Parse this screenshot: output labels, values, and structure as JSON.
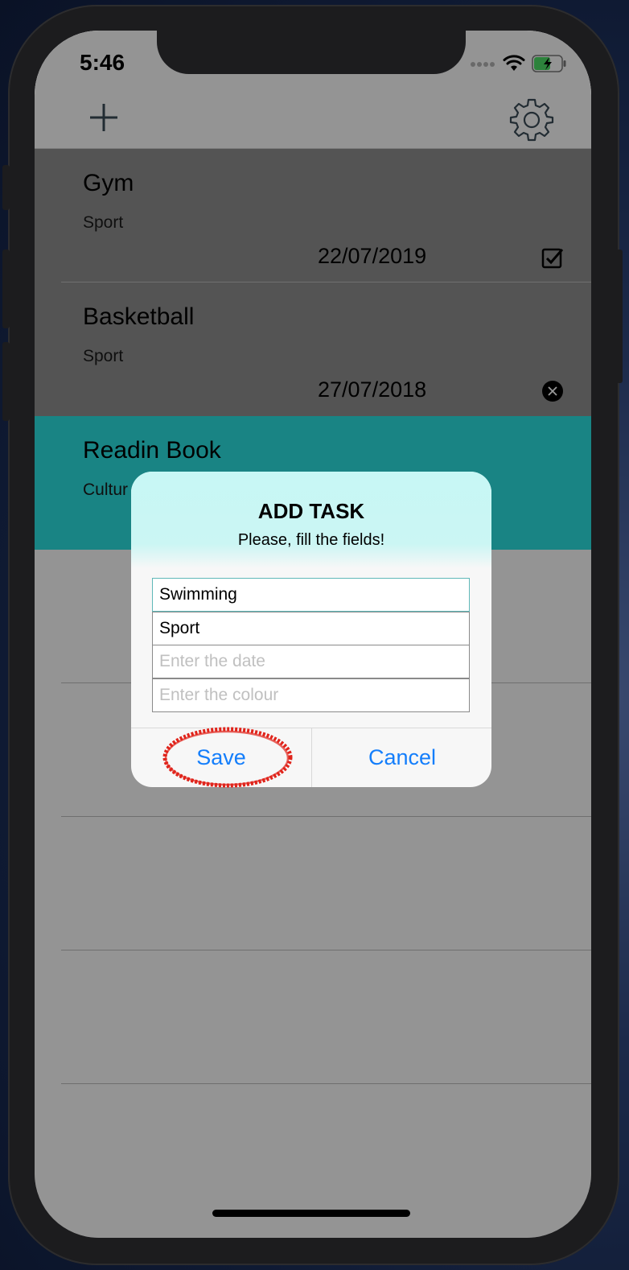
{
  "status_bar": {
    "time": "5:46"
  },
  "nav": {
    "add_icon": "plus-icon",
    "settings_icon": "gear-icon"
  },
  "tasks": [
    {
      "title": "Gym",
      "category": "Sport",
      "date": "22/07/2019",
      "status_icon": "checkbox-checked-icon",
      "color": "#8c8c8c"
    },
    {
      "title": "Basketball",
      "category": "Sport",
      "date": "27/07/2018",
      "status_icon": "close-circle-icon",
      "color": "#8c8c8c"
    },
    {
      "title": "Readin Book",
      "category": "Cultur",
      "color": "#2bdcdc"
    }
  ],
  "dialog": {
    "title": "ADD TASK",
    "subtitle": "Please, fill the fields!",
    "fields": [
      {
        "value": "Swimming",
        "placeholder": ""
      },
      {
        "value": "Sport",
        "placeholder": ""
      },
      {
        "value": "",
        "placeholder": "Enter the date"
      },
      {
        "value": "",
        "placeholder": "Enter the colour"
      }
    ],
    "save_label": "Save",
    "cancel_label": "Cancel"
  },
  "colors": {
    "accent": "#147efb",
    "highlight_row": "#2bdcdc",
    "done_row": "#8c8c8c",
    "annotation": "#e0241b"
  }
}
